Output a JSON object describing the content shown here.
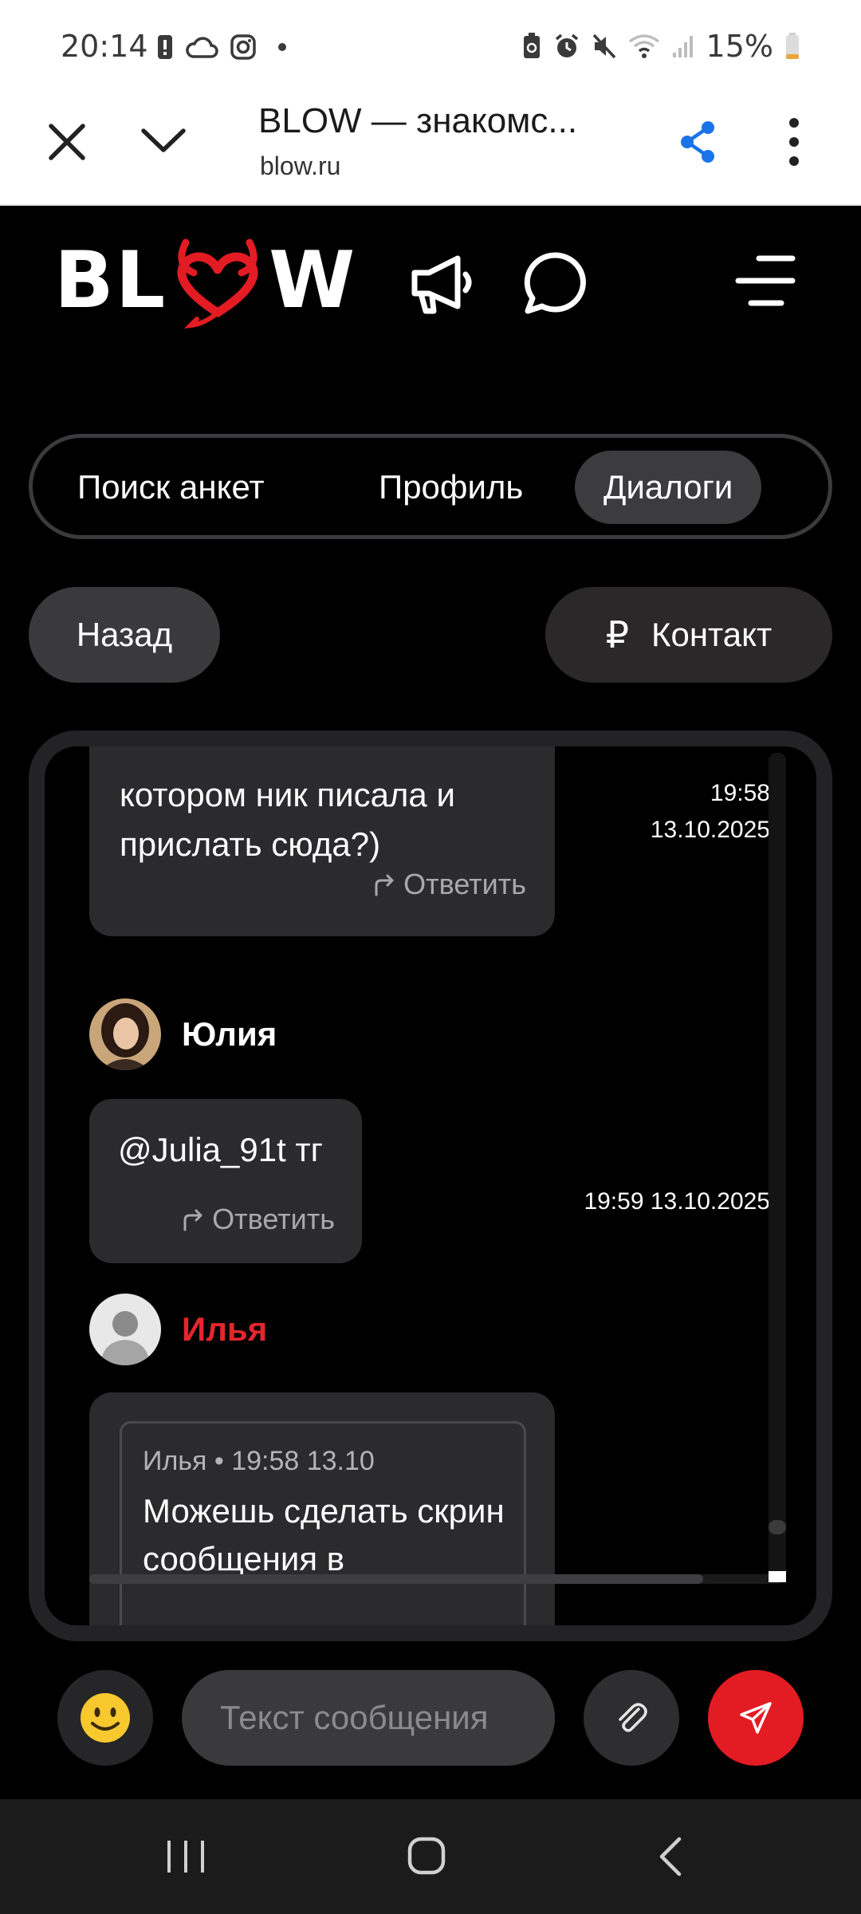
{
  "status_bar": {
    "time": "20:14",
    "battery_percent": "15%",
    "left_icons": [
      "alert-icon",
      "cloud-icon",
      "instagram-icon",
      "dot-icon"
    ],
    "right_icons": [
      "battery-saver-icon",
      "alarm-icon",
      "mute-icon",
      "wifi-icon",
      "signal-icon",
      "battery-icon"
    ]
  },
  "browser": {
    "title": "BLOW — знакомс...",
    "url": "blow.ru",
    "accent_color": "#1a73e8"
  },
  "app": {
    "logo_left": "BL",
    "logo_right": "W",
    "brand_color": "#e31b23"
  },
  "tabs": [
    {
      "label": "Поиск анкет",
      "active": false
    },
    {
      "label": "Профиль",
      "active": false
    },
    {
      "label": "Диалоги",
      "active": true
    }
  ],
  "actions": {
    "back_label": "Назад",
    "contact_symbol": "₽",
    "contact_label": "Контакт"
  },
  "messages": [
    {
      "text": "котором ник писала и прислать сюда?)",
      "time": "19:58\n13.10.2025",
      "reply_label": "Ответить"
    },
    {
      "author": "Юлия",
      "text": "@Julia_91t тг",
      "time": "19:59 13.10.2025",
      "reply_label": "Ответить"
    },
    {
      "author": "Илья",
      "quote_meta": "Илья • 19:58 13.10",
      "quote_text": "Можешь сделать скрин сообщения в"
    }
  ],
  "composer": {
    "placeholder": "Текст сообщения"
  }
}
